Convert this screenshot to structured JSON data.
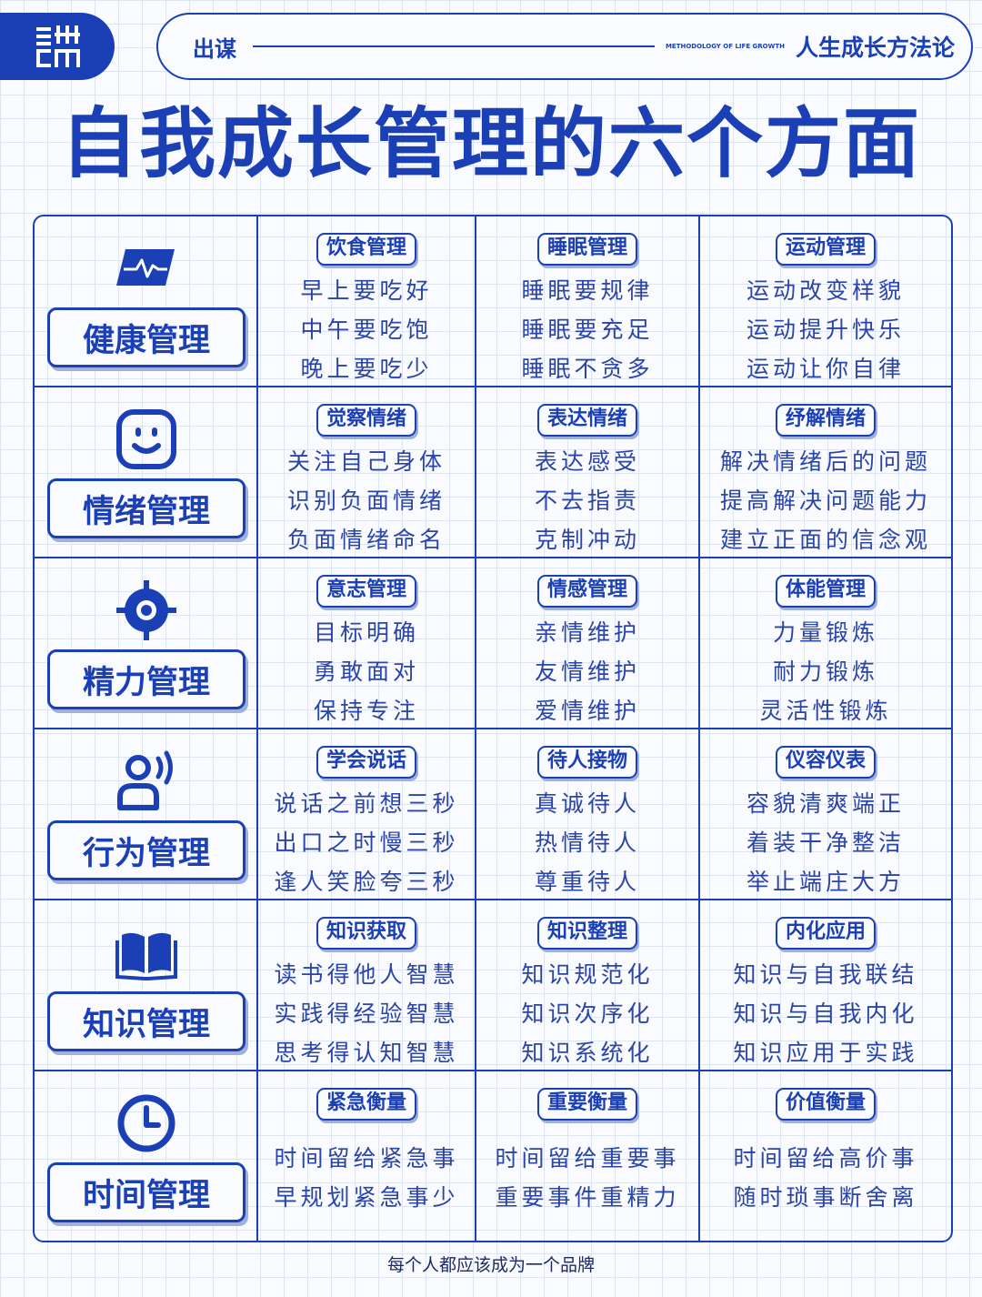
{
  "header": {
    "logo_text": "出谋",
    "brand": "出谋",
    "english": "METHODOLOGY OF LIFE GROWTH",
    "slogan": "人生成长方法论"
  },
  "title": "自我成长管理的六个方面",
  "colors": {
    "primary": "#1b3fb5",
    "grid": "#dfe4f1",
    "background": "#fafbfe"
  },
  "rows": [
    {
      "category": "健康管理",
      "icon": "pulse-monitor-icon",
      "cells": [
        {
          "title": "饮食管理",
          "items": [
            "早上要吃好",
            "中午要吃饱",
            "晚上要吃少"
          ]
        },
        {
          "title": "睡眠管理",
          "items": [
            "睡眠要规律",
            "睡眠要充足",
            "睡眠不贪多"
          ]
        },
        {
          "title": "运动管理",
          "items": [
            "运动改变样貌",
            "运动提升快乐",
            "运动让你自律"
          ]
        }
      ]
    },
    {
      "category": "情绪管理",
      "icon": "smiley-face-icon",
      "cells": [
        {
          "title": "觉察情绪",
          "items": [
            "关注自己身体",
            "识别负面情绪",
            "负面情绪命名"
          ]
        },
        {
          "title": "表达情绪",
          "items": [
            "表达感受",
            "不去指责",
            "克制冲动"
          ]
        },
        {
          "title": "纾解情绪",
          "items": [
            "解决情绪后的问题",
            "提高解决问题能力",
            "建立正面的信念观"
          ]
        }
      ]
    },
    {
      "category": "精力管理",
      "icon": "target-icon",
      "cells": [
        {
          "title": "意志管理",
          "items": [
            "目标明确",
            "勇敢面对",
            "保持专注"
          ]
        },
        {
          "title": "情感管理",
          "items": [
            "亲情维护",
            "友情维护",
            "爱情维护"
          ]
        },
        {
          "title": "体能管理",
          "items": [
            "力量锻炼",
            "耐力锻炼",
            "灵活性锻炼"
          ]
        }
      ]
    },
    {
      "category": "行为管理",
      "icon": "person-speaking-icon",
      "cells": [
        {
          "title": "学会说话",
          "items": [
            "说话之前想三秒",
            "出口之时慢三秒",
            "逢人笑脸夸三秒"
          ]
        },
        {
          "title": "待人接物",
          "items": [
            "真诚待人",
            "热情待人",
            "尊重待人"
          ]
        },
        {
          "title": "仪容仪表",
          "items": [
            "容貌清爽端正",
            "着装干净整洁",
            "举止端庄大方"
          ]
        }
      ]
    },
    {
      "category": "知识管理",
      "icon": "open-book-icon",
      "cells": [
        {
          "title": "知识获取",
          "items": [
            "读书得他人智慧",
            "实践得经验智慧",
            "思考得认知智慧"
          ]
        },
        {
          "title": "知识整理",
          "items": [
            "知识规范化",
            "知识次序化",
            "知识系统化"
          ]
        },
        {
          "title": "内化应用",
          "items": [
            "知识与自我联结",
            "知识与自我内化",
            "知识应用于实践"
          ]
        }
      ]
    },
    {
      "category": "时间管理",
      "icon": "clock-icon",
      "cells": [
        {
          "title": "紧急衡量",
          "items": [
            "时间留给紧急事",
            "早规划紧急事少"
          ]
        },
        {
          "title": "重要衡量",
          "items": [
            "时间留给重要事",
            "重要事件重精力"
          ]
        },
        {
          "title": "价值衡量",
          "items": [
            "时间留给高价事",
            "随时琐事断舍离"
          ]
        }
      ]
    }
  ],
  "footer": "每个人都应该成为一个品牌"
}
